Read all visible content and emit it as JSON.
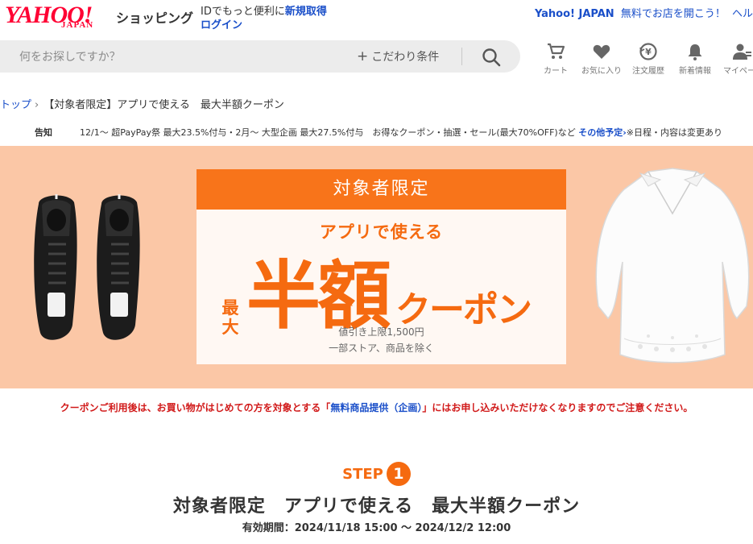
{
  "header": {
    "logo_yahoo": "YAHOO!",
    "logo_japan": "JAPAN",
    "logo_shopping": "ショッピング",
    "id_text": "IDでもっと便利に",
    "register_link": "新規取得",
    "login_link": "ログイン",
    "yahoo_japan_link": "Yahoo! JAPAN",
    "open_store_link": "無料でお店を開こう！",
    "help_link": "ヘル"
  },
  "search": {
    "placeholder": "何をお探しですか？",
    "kodawari_label": "こだわり条件",
    "kodawari_prefix": "+"
  },
  "nav": [
    {
      "label": "カート",
      "icon": "cart-icon"
    },
    {
      "label": "お気に入り",
      "icon": "heart-icon"
    },
    {
      "label": "注文履歴",
      "icon": "order-history-icon"
    },
    {
      "label": "新着情報",
      "icon": "bell-icon"
    },
    {
      "label": "マイペー",
      "icon": "user-icon"
    }
  ],
  "breadcrumb": {
    "top": "トップ",
    "current": "【対象者限定】アプリで使える　最大半額クーポン"
  },
  "notice": {
    "label": "告知",
    "text": "12/1～ 超PayPay祭 最大23.5%付与・2月～ 大型企画 最大27.5%付与　お得なクーポン・抽選・セール(最大70%OFF)など",
    "link": "その他予定",
    "suffix": "※日程・内容は変更あり"
  },
  "banner": {
    "head": "対象者限定",
    "app": "アプリで使える",
    "max": "最大",
    "half": "半額",
    "coupon": "クーポン",
    "limit1": "値引き上限1,500円",
    "limit2": "一部ストア、商品を除く"
  },
  "warning": {
    "pre": "クーポンご利用後は、お買い物がはじめての方を対象とする「",
    "link": "無料商品提供（企画）",
    "post": "」にはお申し込みいただけなくなりますのでご注意ください。"
  },
  "step": {
    "label": "STEP",
    "number": "1",
    "title": "対象者限定　アプリで使える　最大半額クーポン",
    "period": "有効期間：2024/11/18 15:00 ～ 2024/12/2 12:00"
  },
  "colors": {
    "brand_red": "#ff0033",
    "accent_orange": "#f56a10",
    "banner_bg": "#fbc7a6",
    "link_blue": "#1a4fc9",
    "warning_red": "#d11a1a"
  }
}
